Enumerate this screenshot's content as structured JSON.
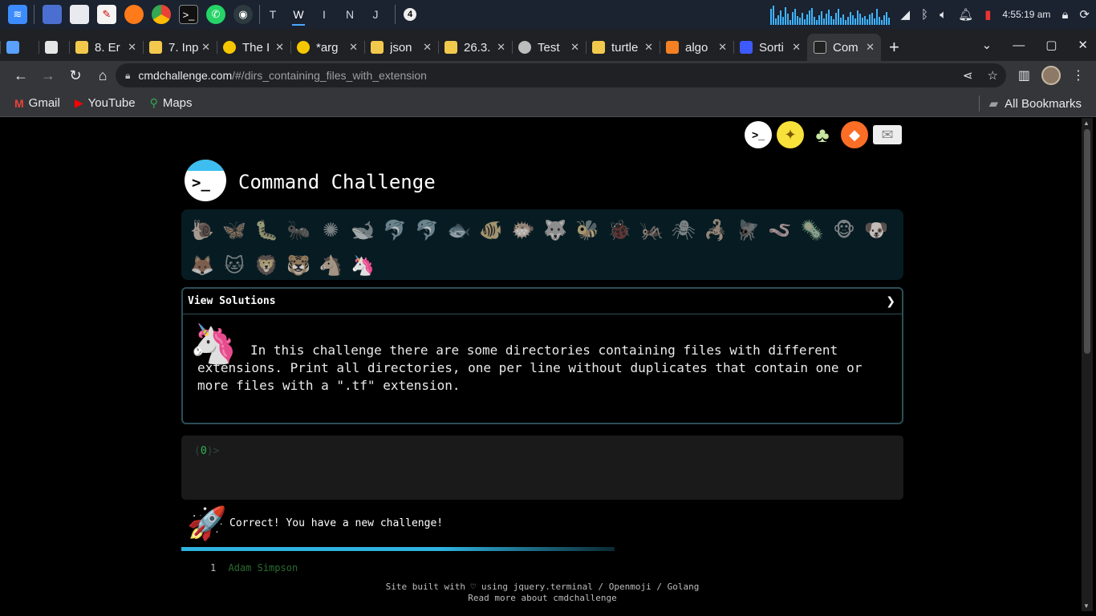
{
  "taskbar": {
    "letters": [
      "T",
      "W",
      "I",
      "N",
      "J"
    ],
    "active_letter": "W",
    "badge": "4",
    "clock": "4:55:19 am"
  },
  "tabs": [
    {
      "label": "",
      "favicon": "#5aa0ff"
    },
    {
      "label": "",
      "favicon": "#e6e6e6"
    },
    {
      "label": "8. Er",
      "favicon": "#f2c94c"
    },
    {
      "label": "7. Inp",
      "favicon": "#f2c94c"
    },
    {
      "label": "The I",
      "favicon": "#f6c700"
    },
    {
      "label": "*arg",
      "favicon": "#f6c700"
    },
    {
      "label": "json",
      "favicon": "#f2c94c"
    },
    {
      "label": "26.3.",
      "favicon": "#f2c94c"
    },
    {
      "label": "Test",
      "favicon": "#bdbdbd"
    },
    {
      "label": "turtle",
      "favicon": "#f2c94c"
    },
    {
      "label": "algo",
      "favicon": "#f48024"
    },
    {
      "label": "Sorti",
      "favicon": "#3d5afe"
    },
    {
      "label": "Com",
      "favicon": "#222222",
      "active": true
    }
  ],
  "address": {
    "host": "cmdchallenge.com",
    "path": "/#/dirs_containing_files_with_extension"
  },
  "bookmarks": [
    {
      "label": "Gmail",
      "icon": "gmail-icon",
      "color": "#ea4335"
    },
    {
      "label": "YouTube",
      "icon": "youtube-icon",
      "color": "#ff0000"
    },
    {
      "label": "Maps",
      "icon": "maps-icon",
      "color": "#34a853"
    }
  ],
  "bookmarks_all": "All Bookmarks",
  "page": {
    "site_title": "Command Challenge",
    "animals": [
      "snail",
      "butterfly",
      "caterpillar",
      "ant",
      "sun-bug",
      "whale",
      "dolphin-blue",
      "dolphin",
      "fish",
      "tropical-fish",
      "blowfish",
      "wolf",
      "bee",
      "ladybug",
      "cricket",
      "spider",
      "scorpion",
      "fly",
      "worm",
      "microbe",
      "monkey",
      "dog",
      "fox",
      "cat",
      "lion",
      "tiger",
      "horse",
      "unicorn"
    ],
    "solutions_label": "View Solutions",
    "solutions_chevron": "❯",
    "challenge_text": "In this challenge there are some directories containing files with different extensions. Print all directories, one per line without duplicates that contain one or more files with a \".tf\" extension.",
    "terminal": {
      "count": "0",
      "prompt": ">"
    },
    "success": "Correct! You have a new challenge!",
    "author": {
      "line_no": "1",
      "name": "Adam Simpson"
    },
    "footer_line1": "Site built with ♡ using jquery.terminal / Openmoji / Golang",
    "footer_line2": "Read more about cmdchallenge"
  },
  "colors": {
    "accent": "#2fb3e0",
    "terminal_green": "#2eb84f",
    "panel_bg": "#071c22",
    "box_border": "#2b4e57"
  }
}
